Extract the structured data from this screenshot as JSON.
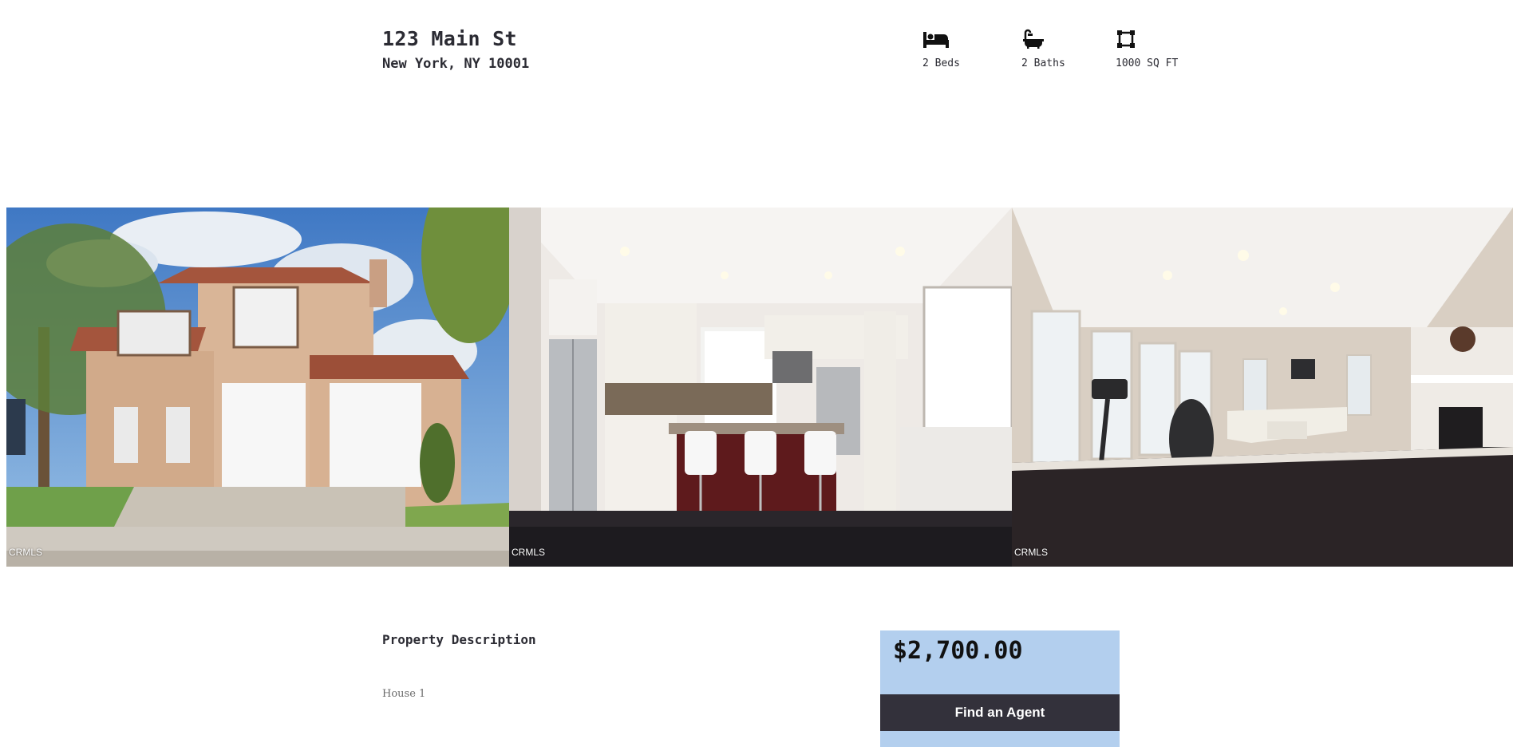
{
  "listing": {
    "street": "123 Main St",
    "city_state_zip": "New York, NY 10001"
  },
  "features": [
    {
      "icon": "bed-icon",
      "label": "2 Beds"
    },
    {
      "icon": "bath-icon",
      "label": "2 Baths"
    },
    {
      "icon": "area-icon",
      "label": "1000 SQ FT"
    }
  ],
  "gallery": {
    "photos": [
      {
        "subject": "house exterior",
        "watermark": "CRMLS"
      },
      {
        "subject": "kitchen",
        "watermark": "CRMLS"
      },
      {
        "subject": "living room",
        "watermark": "CRMLS"
      }
    ]
  },
  "description": {
    "title": "Property Description",
    "body": "House 1"
  },
  "pricing": {
    "price": "$2,700.00",
    "agent_button_label": "Find an Agent"
  },
  "colors": {
    "price_card_bg": "#b3cfee",
    "button_bg": "#33313b",
    "text": "#2b2b33"
  }
}
